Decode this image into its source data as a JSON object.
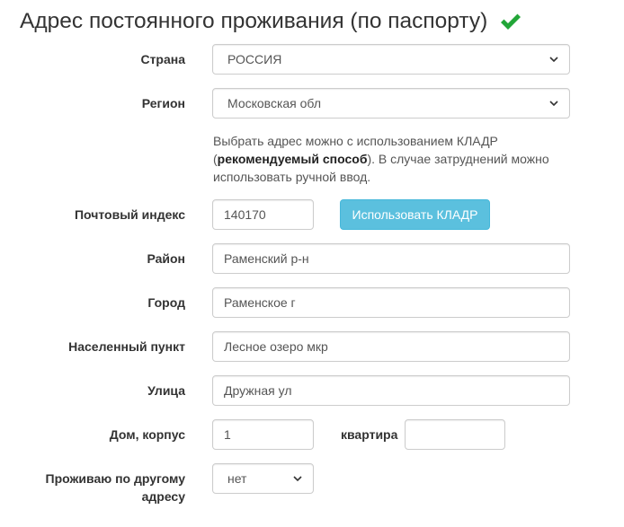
{
  "section": {
    "title": "Адрес постоянного проживания (по паспорту)",
    "status_icon": "check-icon",
    "status_color": "#22a638"
  },
  "help_text": {
    "line1": "Выбрать адрес можно с использованием КЛАДР",
    "open_paren": "(",
    "bold": "рекомендуемый способ",
    "rest": "). В случае затруднений можно",
    "line3": "использовать ручной ввод."
  },
  "fields": {
    "country": {
      "label": "Страна",
      "value": "РОССИЯ"
    },
    "region": {
      "label": "Регион",
      "value": "Московская обл"
    },
    "postal": {
      "label": "Почтовый индекс",
      "value": "140170"
    },
    "kladr_button": {
      "label": "Использовать КЛАДР",
      "color": "#5bc0de"
    },
    "district": {
      "label": "Район",
      "value": "Раменский р-н"
    },
    "city": {
      "label": "Город",
      "value": "Раменское г"
    },
    "settlement": {
      "label": "Населенный пункт",
      "value": "Лесное озеро мкр"
    },
    "street": {
      "label": "Улица",
      "value": "Дружная ул"
    },
    "house": {
      "label": "Дом, корпус",
      "value": "1"
    },
    "apartment": {
      "label": "квартира",
      "value": ""
    },
    "other_address": {
      "label": "Проживаю по другому адресу",
      "value": "нет"
    }
  }
}
